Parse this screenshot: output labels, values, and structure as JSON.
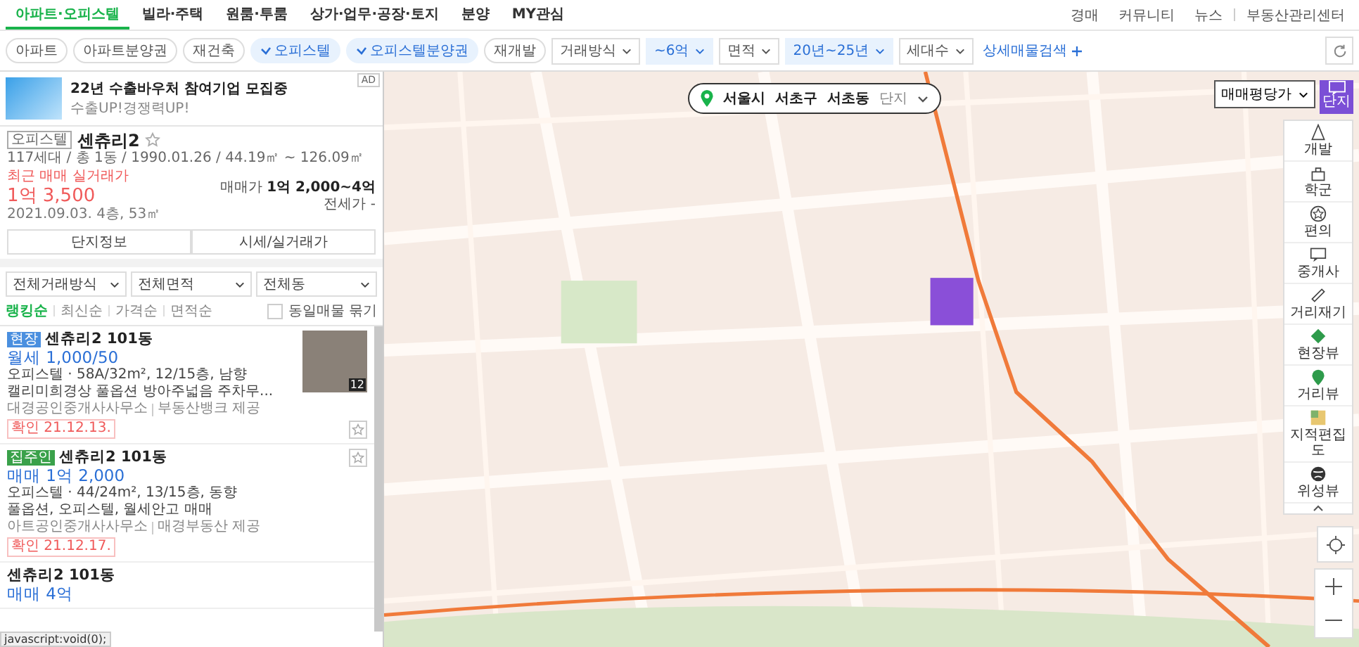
{
  "nav": {
    "tabs": [
      {
        "label": "아파트·오피스텔",
        "selected": true
      },
      {
        "label": "빌라·주택",
        "selected": false
      },
      {
        "label": "원룸·투룸",
        "selected": false
      },
      {
        "label": "상가·업무·공장·토지",
        "selected": false
      },
      {
        "label": "분양",
        "selected": false
      },
      {
        "label": "MY관심",
        "selected": false
      }
    ],
    "links": [
      "경매",
      "커뮤니티",
      "뉴스",
      "부동산관리센터"
    ]
  },
  "filters": {
    "items": [
      {
        "kind": "chip",
        "label": "아파트",
        "selected": false
      },
      {
        "kind": "chip",
        "label": "아파트분양권",
        "selected": false
      },
      {
        "kind": "chip",
        "label": "재건축",
        "selected": false
      },
      {
        "kind": "chip",
        "label": "오피스텔",
        "selected": true
      },
      {
        "kind": "chip",
        "label": "오피스텔분양권",
        "selected": true
      },
      {
        "kind": "chip",
        "label": "재개발",
        "selected": false
      },
      {
        "kind": "dropdown",
        "label": "거래방식",
        "selected": false
      },
      {
        "kind": "dropdown",
        "label": "~6억",
        "selected": true
      },
      {
        "kind": "dropdown",
        "label": "면적",
        "selected": false
      },
      {
        "kind": "dropdown",
        "label": "20년~25년",
        "selected": true
      },
      {
        "kind": "dropdown",
        "label": "세대수",
        "selected": false
      }
    ],
    "detail_search": "상세매물검색"
  },
  "ad": {
    "badge": "AD",
    "title": "22년 수출바우처 참여기업 모집중",
    "subtitle": "수출UP!경쟁력UP!"
  },
  "complex": {
    "type": "오피스텔",
    "name": "센츄리2",
    "favorite": false,
    "info": "117세대 / 총 1동 / 1990.01.26 / 44.19㎡ ~ 126.09㎡",
    "recent_label": "최근 매매 실거래가",
    "recent_price": "1억 3,500",
    "recent_date": "2021.09.03. 4층, 53㎡",
    "sale_label": "매매가",
    "sale_price": "1억 2,000~4억",
    "jeonse_label": "전세가",
    "jeonse_price": "-",
    "buttons": [
      "단지정보",
      "시세/실거래가"
    ]
  },
  "list_filters": [
    "전체거래방식",
    "전체면적",
    "전체동"
  ],
  "sort": [
    {
      "label": "랭킹순",
      "selected": true
    },
    {
      "label": "최신순",
      "selected": false
    },
    {
      "label": "가격순",
      "selected": false
    },
    {
      "label": "면적순",
      "selected": false
    }
  ],
  "group_same": {
    "label": "동일매물 묶기",
    "checked": false
  },
  "listings": [
    {
      "tag": {
        "label": "현장",
        "color": "#4a8fdf"
      },
      "title": "센츄리2 101동",
      "price": "월세 1,000/50",
      "details": "오피스텔 · 58A/32m², 12/15층, 남향",
      "description": "캘리미희경상 풀옵션 방아주넓음 주차무...",
      "agency": "대경공인중개사사무소",
      "provider": "부동산뱅크 제공",
      "confirmed": "확인 21.12.13.",
      "photo_count": "12",
      "favorite": false
    },
    {
      "tag": {
        "label": "집주인",
        "color": "#3aa14a"
      },
      "title": "센츄리2 101동",
      "price": "매매 1억 2,000",
      "details": "오피스텔 · 44/24m², 13/15층, 동향",
      "description": "풀옵션, 오피스텔, 월세안고 매매",
      "agency": "아트공인중개사사무소",
      "provider": "매경부동산 제공",
      "confirmed": "확인 21.12.17.",
      "favorite": false
    },
    {
      "title": "센츄리2 101동",
      "price": "매매 4억"
    }
  ],
  "map": {
    "breadcrumb": [
      "서울시",
      "서초구",
      "서초동",
      "단지"
    ],
    "price_type": "매매평당가",
    "complex_button": "단지",
    "tools": [
      "개발",
      "학군",
      "편의",
      "중개사",
      "거리재기",
      "현장뷰",
      "거리뷰",
      "지적편집도",
      "위성뷰"
    ]
  },
  "status_bar": "javascript:void(0);"
}
